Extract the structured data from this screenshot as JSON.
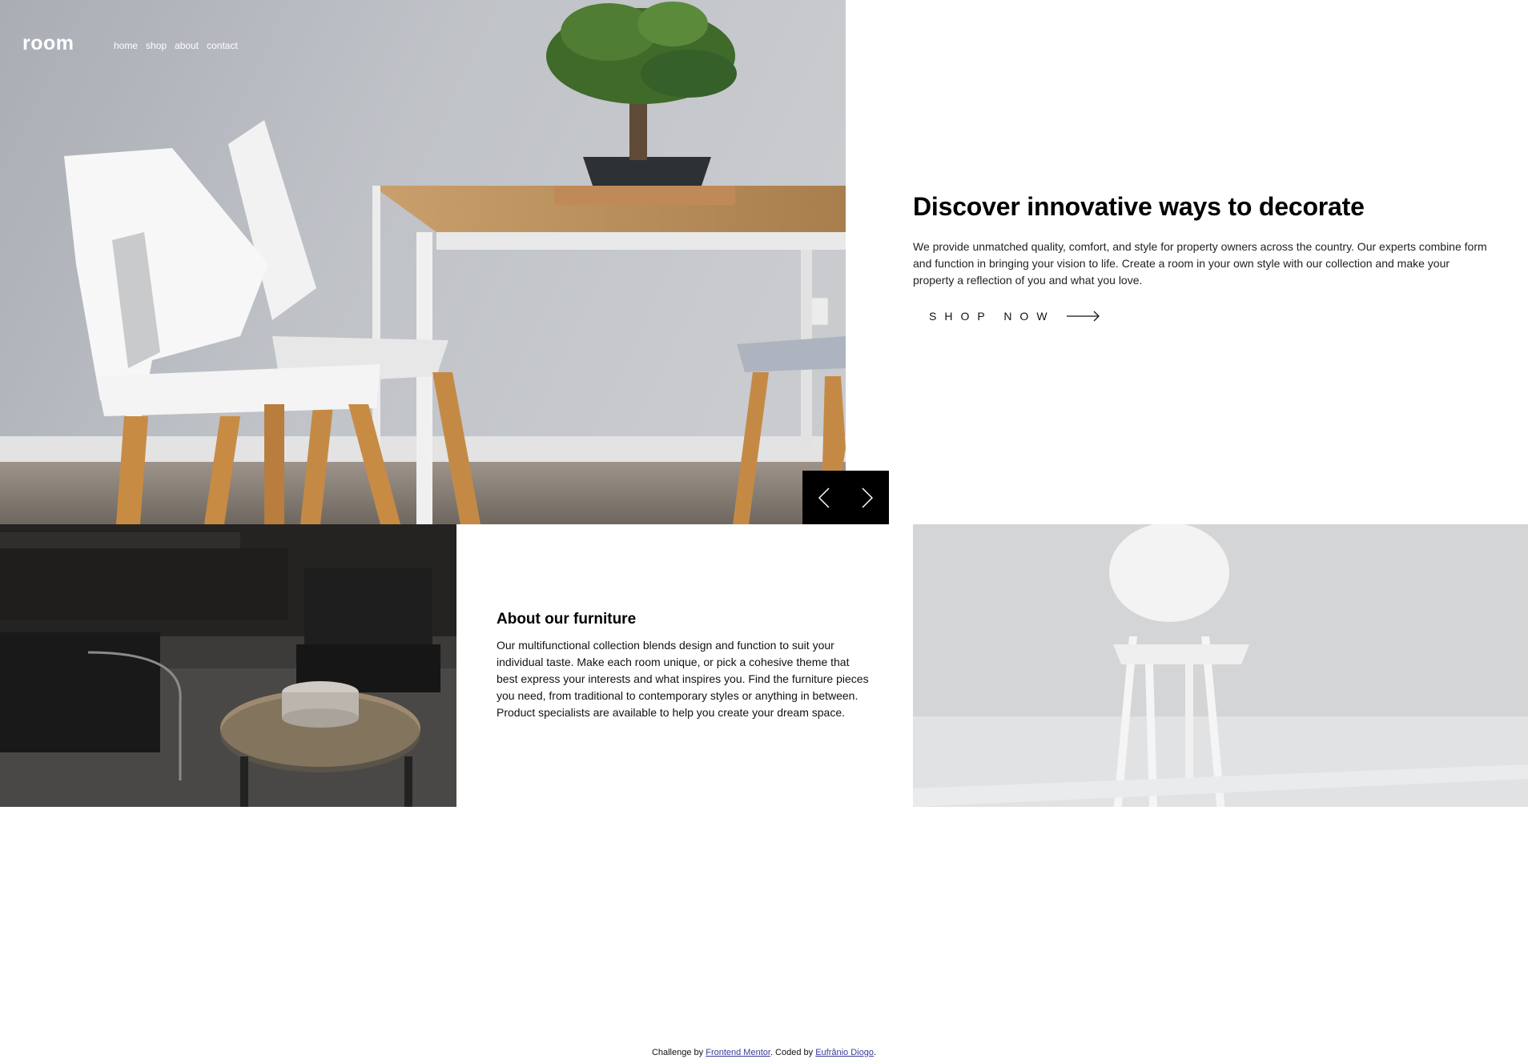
{
  "brand": {
    "logo": "room"
  },
  "nav": {
    "items": [
      "home",
      "shop",
      "about",
      "contact"
    ]
  },
  "hero": {
    "title": "Discover innovative ways to decorate",
    "description": "We provide unmatched quality, comfort, and style for property owners across the country. Our experts combine form and function in bringing your vision to life. Create a room in your own style with our collection and make your property a reflection of you and what you love.",
    "cta_label": "SHOP NOW",
    "image_icon": "dining-chairs-photo"
  },
  "slider": {
    "prev_icon": "chevron-left-icon",
    "next_icon": "chevron-right-icon"
  },
  "about": {
    "title": "About our furniture",
    "description": "Our multifunctional collection blends design and function to suit your individual taste. Make each room unique, or pick a cohesive theme that best express your interests and what inspires you. Find the furniture pieces you need, from traditional to contemporary styles or anything in between. Product specialists are available to help you create your dream space."
  },
  "footer": {
    "prefix": "Challenge by",
    "link1": "Frontend Mentor",
    "middle": ". Coded by",
    "link2": "Eufrânio Diogo",
    "suffix": "."
  },
  "colors": {
    "dark": "#000000",
    "link": "#3a3a9a",
    "wall": "#b9bcc2",
    "wood": "#b8824a"
  }
}
